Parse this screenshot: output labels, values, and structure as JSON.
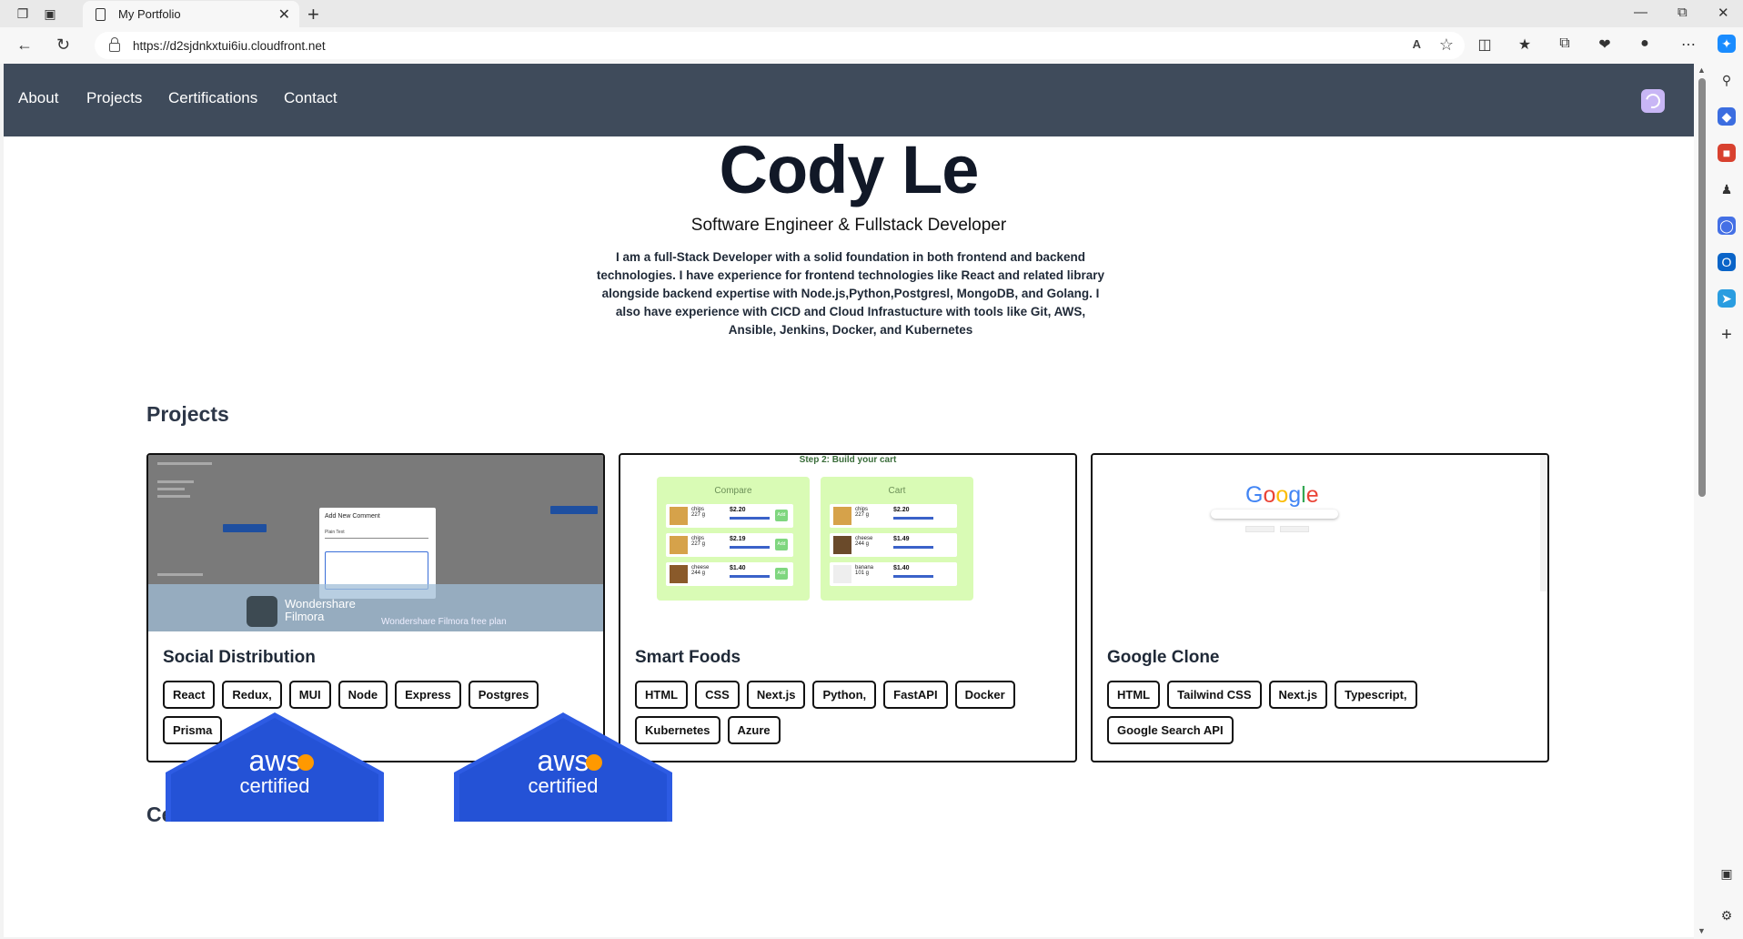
{
  "browser": {
    "tab_title": "My Portfolio",
    "url": "https://d2sjdnkxtui6iu.cloudfront.net",
    "read_aloud_label": "A",
    "icons": [
      "workspaces-icon",
      "tab-actions-icon",
      "back-icon",
      "refresh-icon",
      "favorites-icon",
      "split-screen-icon",
      "collections-icon",
      "extensions-icon",
      "profile-icon",
      "more-icon",
      "copilot-icon"
    ]
  },
  "nav": {
    "items": [
      {
        "label": "About"
      },
      {
        "label": "Projects"
      },
      {
        "label": "Certifications"
      },
      {
        "label": "Contact"
      }
    ]
  },
  "hero": {
    "name": "Cody Le",
    "subtitle": "Software Engineer & Fullstack Developer",
    "bio": "I am a full-Stack Developer with a solid foundation in both frontend and backend technologies. I have experience for frontend technologies like React and related library alongside backend expertise with Node.js,Python,Postgresl, MongoDB, and Golang. I also have experience with CICD and Cloud Infrastucture with tools like Git, AWS, Ansible, Jenkins, Docker, and Kubernetes"
  },
  "projects": {
    "heading": "Projects",
    "items": [
      {
        "title": "Social Distribution",
        "tags": [
          "React",
          "Redux,",
          "MUI",
          "Node",
          "Express",
          "Postgres",
          "Prisma"
        ],
        "thumb": {
          "dialog_title": "Add New Comment",
          "select_value": "Plain Text",
          "watermark_brand": "Wondershare\nFilmora",
          "watermark_sub": "Wondershare Filmora free plan"
        }
      },
      {
        "title": "Smart Foods",
        "tags": [
          "HTML",
          "CSS",
          "Next.js",
          "Python,",
          "FastAPI",
          "Docker",
          "Kubernetes",
          "Azure"
        ],
        "thumb": {
          "header": "Step 2: Build your cart",
          "panel_left": "Compare",
          "panel_right": "Cart",
          "left_rows": [
            {
              "name": "chips\n227 g",
              "price": "$2.20",
              "add": "Add"
            },
            {
              "name": "chips\n227 g",
              "price": "$2.19",
              "add": "Add"
            },
            {
              "name": "cheese\n244 g",
              "price": "$1.40",
              "add": "Add"
            }
          ],
          "right_rows": [
            {
              "name": "chips\n227 g",
              "price": "$2.20"
            },
            {
              "name": "cheese\n244 g",
              "price": "$1.49"
            },
            {
              "name": "banana\n101 g",
              "price": "$1.40"
            }
          ]
        }
      },
      {
        "title": "Google Clone",
        "tags": [
          "HTML",
          "Tailwind CSS",
          "Next.js",
          "Typescript,",
          "Google Search API"
        ],
        "thumb": {
          "logo": "Google"
        }
      }
    ]
  },
  "certifications": {
    "heading": "Certifications",
    "badges": [
      {
        "brand": "aws",
        "text": "certified"
      },
      {
        "brand": "aws",
        "text": "certified"
      }
    ]
  },
  "colors": {
    "nav_bg": "#3f4b5b",
    "theme_toggle": "#c8b6f5",
    "aws_blue": "#2d5be3",
    "aws_orange": "#ff9900"
  }
}
